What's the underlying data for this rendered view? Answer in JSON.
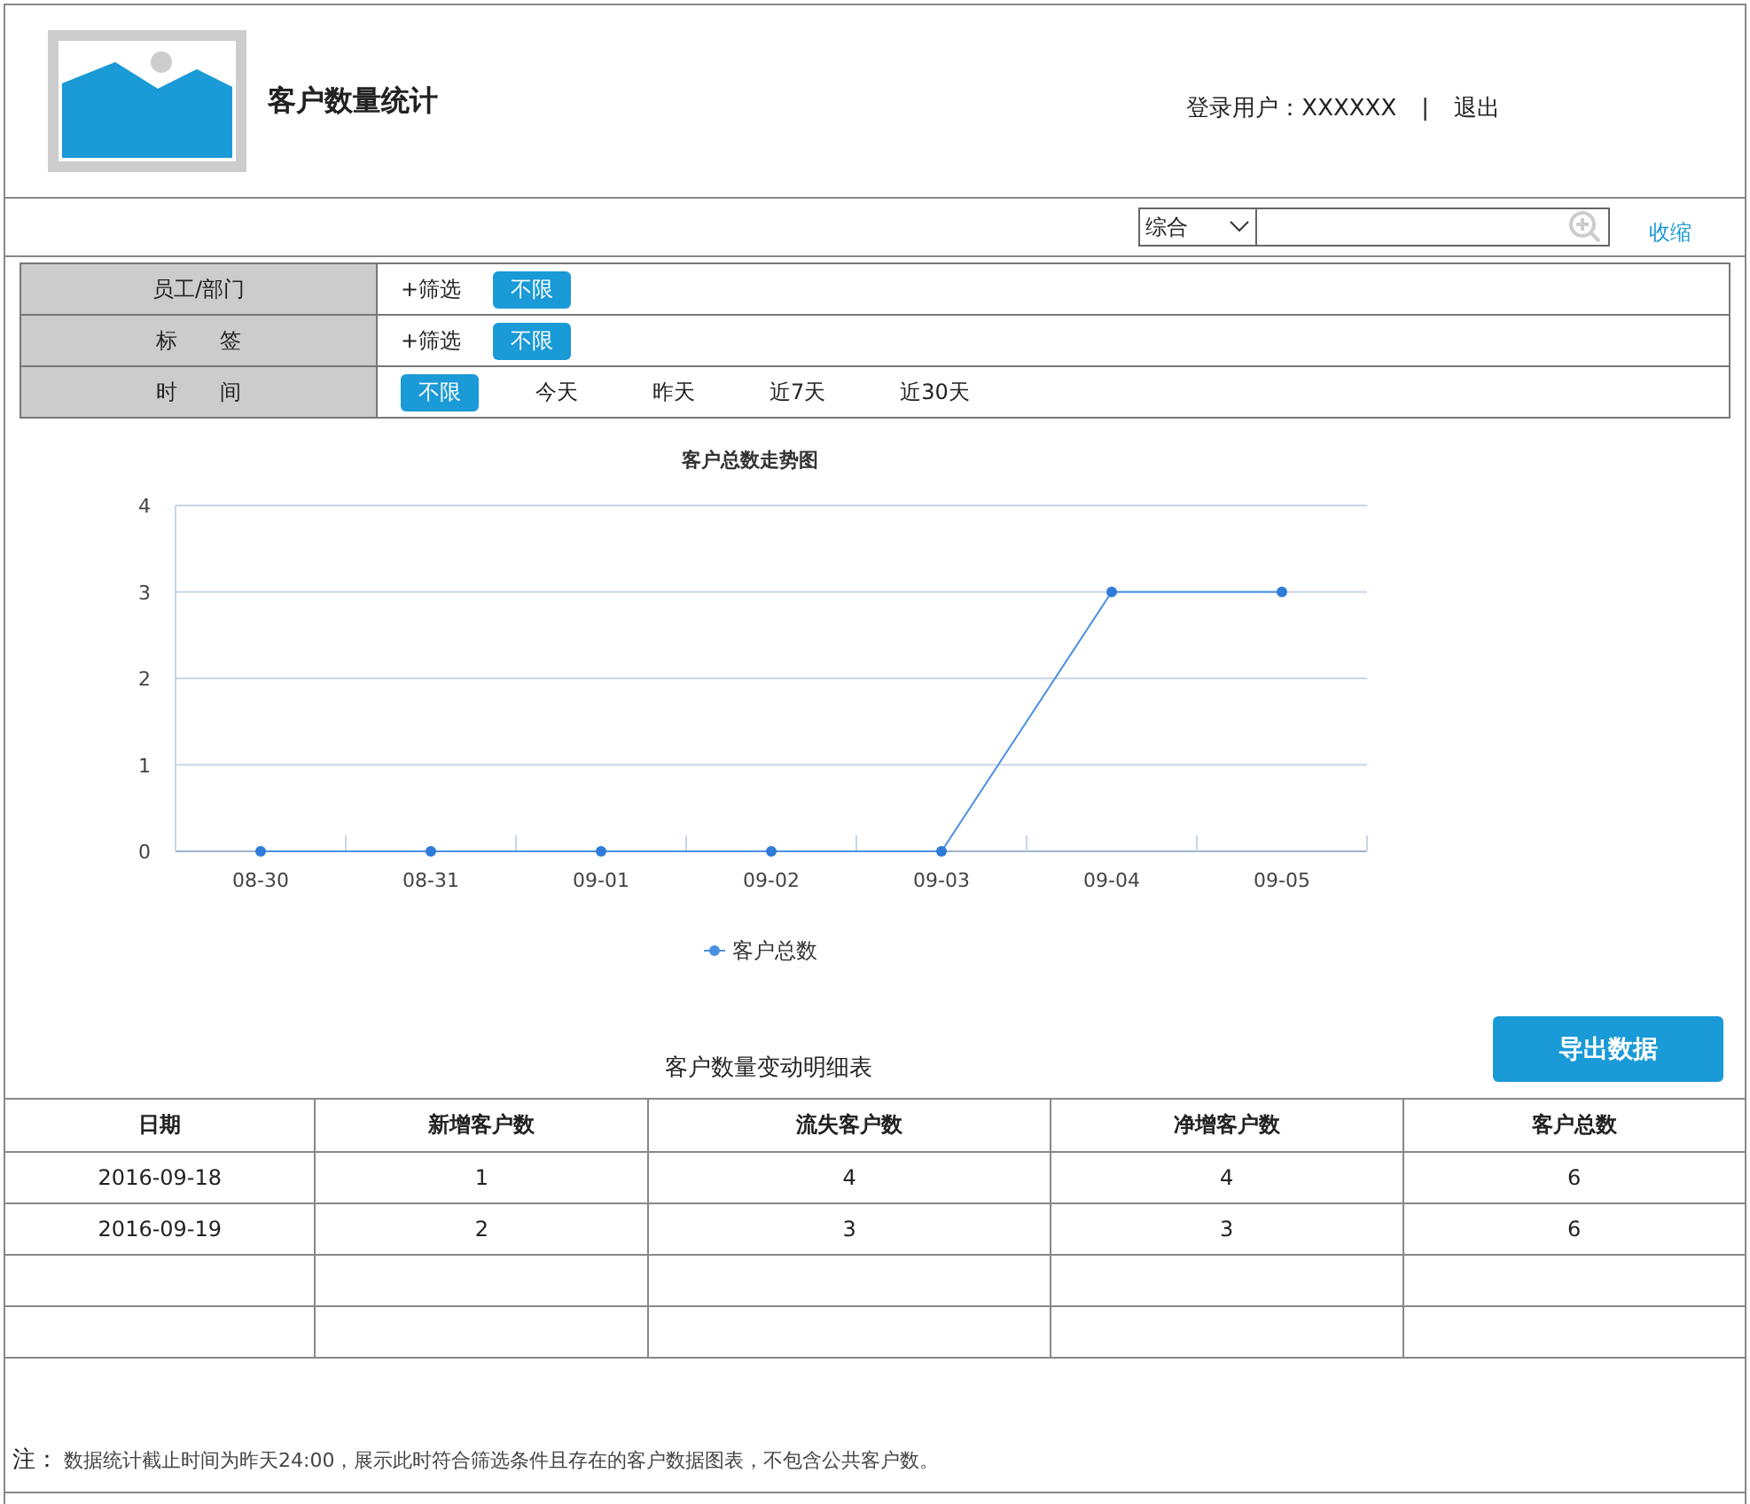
{
  "header": {
    "title": "客户数量统计",
    "user_label": "登录用户：XXXXXX",
    "separator": "|",
    "logout": "退出"
  },
  "toolbar": {
    "scope": "综合",
    "collapse": "收缩"
  },
  "filters": [
    {
      "label": "员工/部门",
      "add": "+筛选",
      "options": [
        {
          "label": "不限",
          "selected": true
        }
      ]
    },
    {
      "label": "标　　签",
      "add": "+筛选",
      "options": [
        {
          "label": "不限",
          "selected": true
        }
      ]
    },
    {
      "label": "时　　间",
      "options": [
        {
          "label": "不限",
          "selected": true
        },
        {
          "label": "今天",
          "selected": false
        },
        {
          "label": "昨天",
          "selected": false
        },
        {
          "label": "近7天",
          "selected": false
        },
        {
          "label": "近30天",
          "selected": false
        }
      ]
    }
  ],
  "chart": {
    "chart_data": {
      "type": "line",
      "title": "客户总数走势图",
      "categories": [
        "08-30",
        "08-31",
        "09-01",
        "09-02",
        "09-03",
        "09-04",
        "09-05"
      ],
      "ylim": [
        0,
        4
      ],
      "grid": true,
      "yticks": [
        0,
        1,
        2,
        3,
        4
      ],
      "series": [
        {
          "name": "客户总数",
          "color": "#4a90e2",
          "marker": true,
          "values": [
            0,
            0,
            0,
            0,
            0,
            3,
            3
          ]
        }
      ]
    }
  },
  "export_button": "导出数据",
  "table": {
    "title": "客户数量变动明细表",
    "columns": [
      "日期",
      "新增客户数",
      "流失客户数",
      "净增客户数",
      "客户总数"
    ],
    "rows": [
      [
        "2016-09-18",
        "1",
        "4",
        "4",
        "6"
      ],
      [
        "2016-09-19",
        "2",
        "3",
        "3",
        "6"
      ]
    ]
  },
  "note": {
    "label": "注：",
    "text": "数据统计截止时间为昨天24:00，展示此时符合筛选条件且存在的客户数据图表，不包含公共客户数。"
  }
}
